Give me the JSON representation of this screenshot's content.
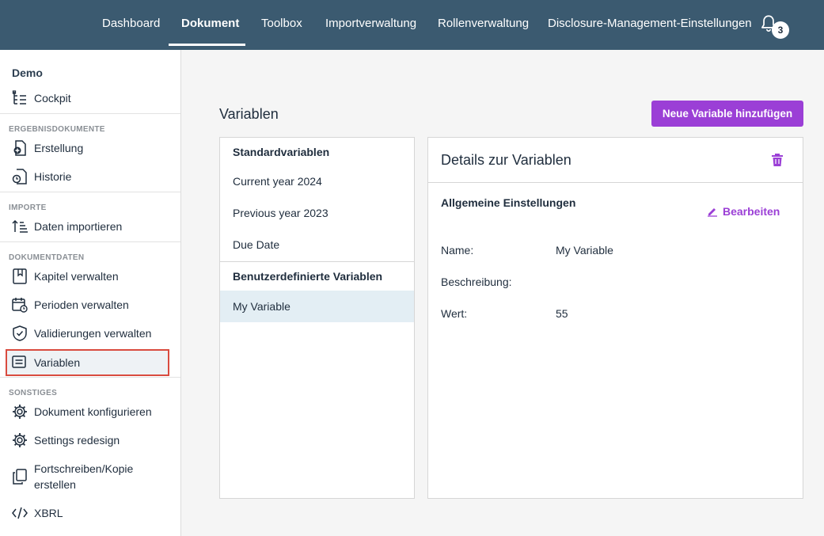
{
  "nav": {
    "items": [
      "Dashboard",
      "Dokument",
      "Toolbox",
      "Importverwaltung",
      "Rollenverwaltung",
      "Disclosure-Management-Einstellungen"
    ],
    "active": "Dokument",
    "notification_count": "3"
  },
  "sidebar": {
    "project": "Demo",
    "cockpit": "Cockpit",
    "sections": {
      "ergebnis": "ERGEBNISDOKUMENTE",
      "importe": "IMPORTE",
      "dokumentdaten": "DOKUMENTDATEN",
      "sonstiges": "SONSTIGES"
    },
    "items": {
      "erstellung": "Erstellung",
      "historie": "Historie",
      "daten_importieren": "Daten importieren",
      "kapitel": "Kapitel verwalten",
      "perioden": "Perioden verwalten",
      "validierungen": "Validierungen verwalten",
      "variablen": "Variablen",
      "konfigurieren": "Dokument konfigurieren",
      "settings": "Settings redesign",
      "fortschreiben_1": "Fortschreiben/Kopie",
      "fortschreiben_2": "erstellen",
      "xbrl": "XBRL"
    },
    "selected": "Variablen"
  },
  "main": {
    "title": "Variablen",
    "add_button": "Neue Variable hinzufügen",
    "list": {
      "standard_header": "Standardvariablen",
      "standard": [
        "Current year 2024",
        "Previous year 2023",
        "Due Date"
      ],
      "custom_header": "Benutzerdefinierte Variablen",
      "custom": [
        "My Variable"
      ],
      "selected": "My Variable"
    },
    "details": {
      "title": "Details zur Variablen",
      "section": "Allgemeine Einstellungen",
      "edit": "Bearbeiten",
      "fields": {
        "name_label": "Name:",
        "name_value": "My Variable",
        "desc_label": "Beschreibung:",
        "desc_value": "",
        "wert_label": "Wert:",
        "wert_value": "55"
      }
    }
  },
  "colors": {
    "topbar": "#3b5a70",
    "accent": "#9b3fd6",
    "selection_outline": "#d94b3f"
  }
}
